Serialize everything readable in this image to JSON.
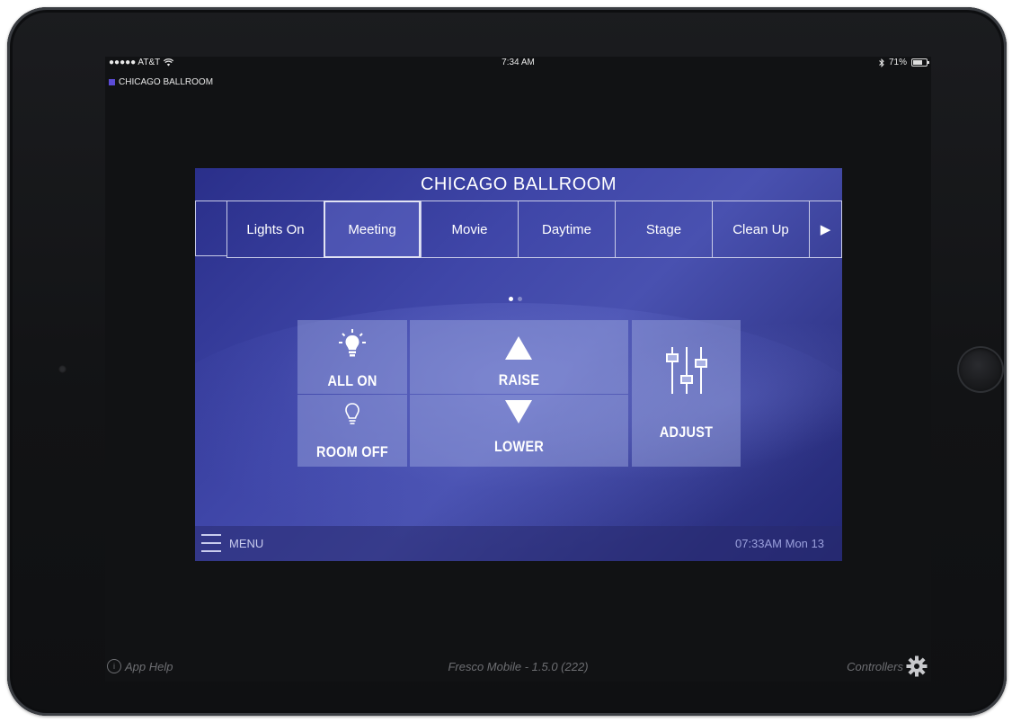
{
  "status_bar": {
    "carrier": "●●●●● AT&T",
    "time": "7:34 AM",
    "battery": "71%",
    "room": "CHICAGO BALLROOM"
  },
  "panel": {
    "title": "CHICAGO BALLROOM",
    "scenes": [
      "Lights On",
      "Meeting",
      "Movie",
      "Daytime",
      "Stage",
      "Clean Up"
    ],
    "active_scene": "Meeting",
    "controls": {
      "all_on": "ALL ON",
      "room_off": "ROOM OFF",
      "raise": "RAISE",
      "lower": "LOWER",
      "adjust": "ADJUST"
    },
    "menu_label": "MENU",
    "clock": "07:33AM  Mon 13",
    "pager": {
      "pages": 2,
      "current": 1
    }
  },
  "footer": {
    "help": "App Help",
    "version": "Fresco Mobile - 1.5.0 (222)",
    "controllers": "Controllers"
  },
  "icons": [
    "wifi-icon",
    "bluetooth-icon",
    "battery-icon",
    "bulb-on-icon",
    "bulb-off-icon",
    "raise-arrow-icon",
    "lower-arrow-icon",
    "sliders-icon",
    "hamburger-icon",
    "next-arrow-icon",
    "info-icon",
    "gear-icon"
  ],
  "colors": {
    "panel": "#3f46a8",
    "accent": "#5b4bd6",
    "control": "#a0aae1"
  }
}
